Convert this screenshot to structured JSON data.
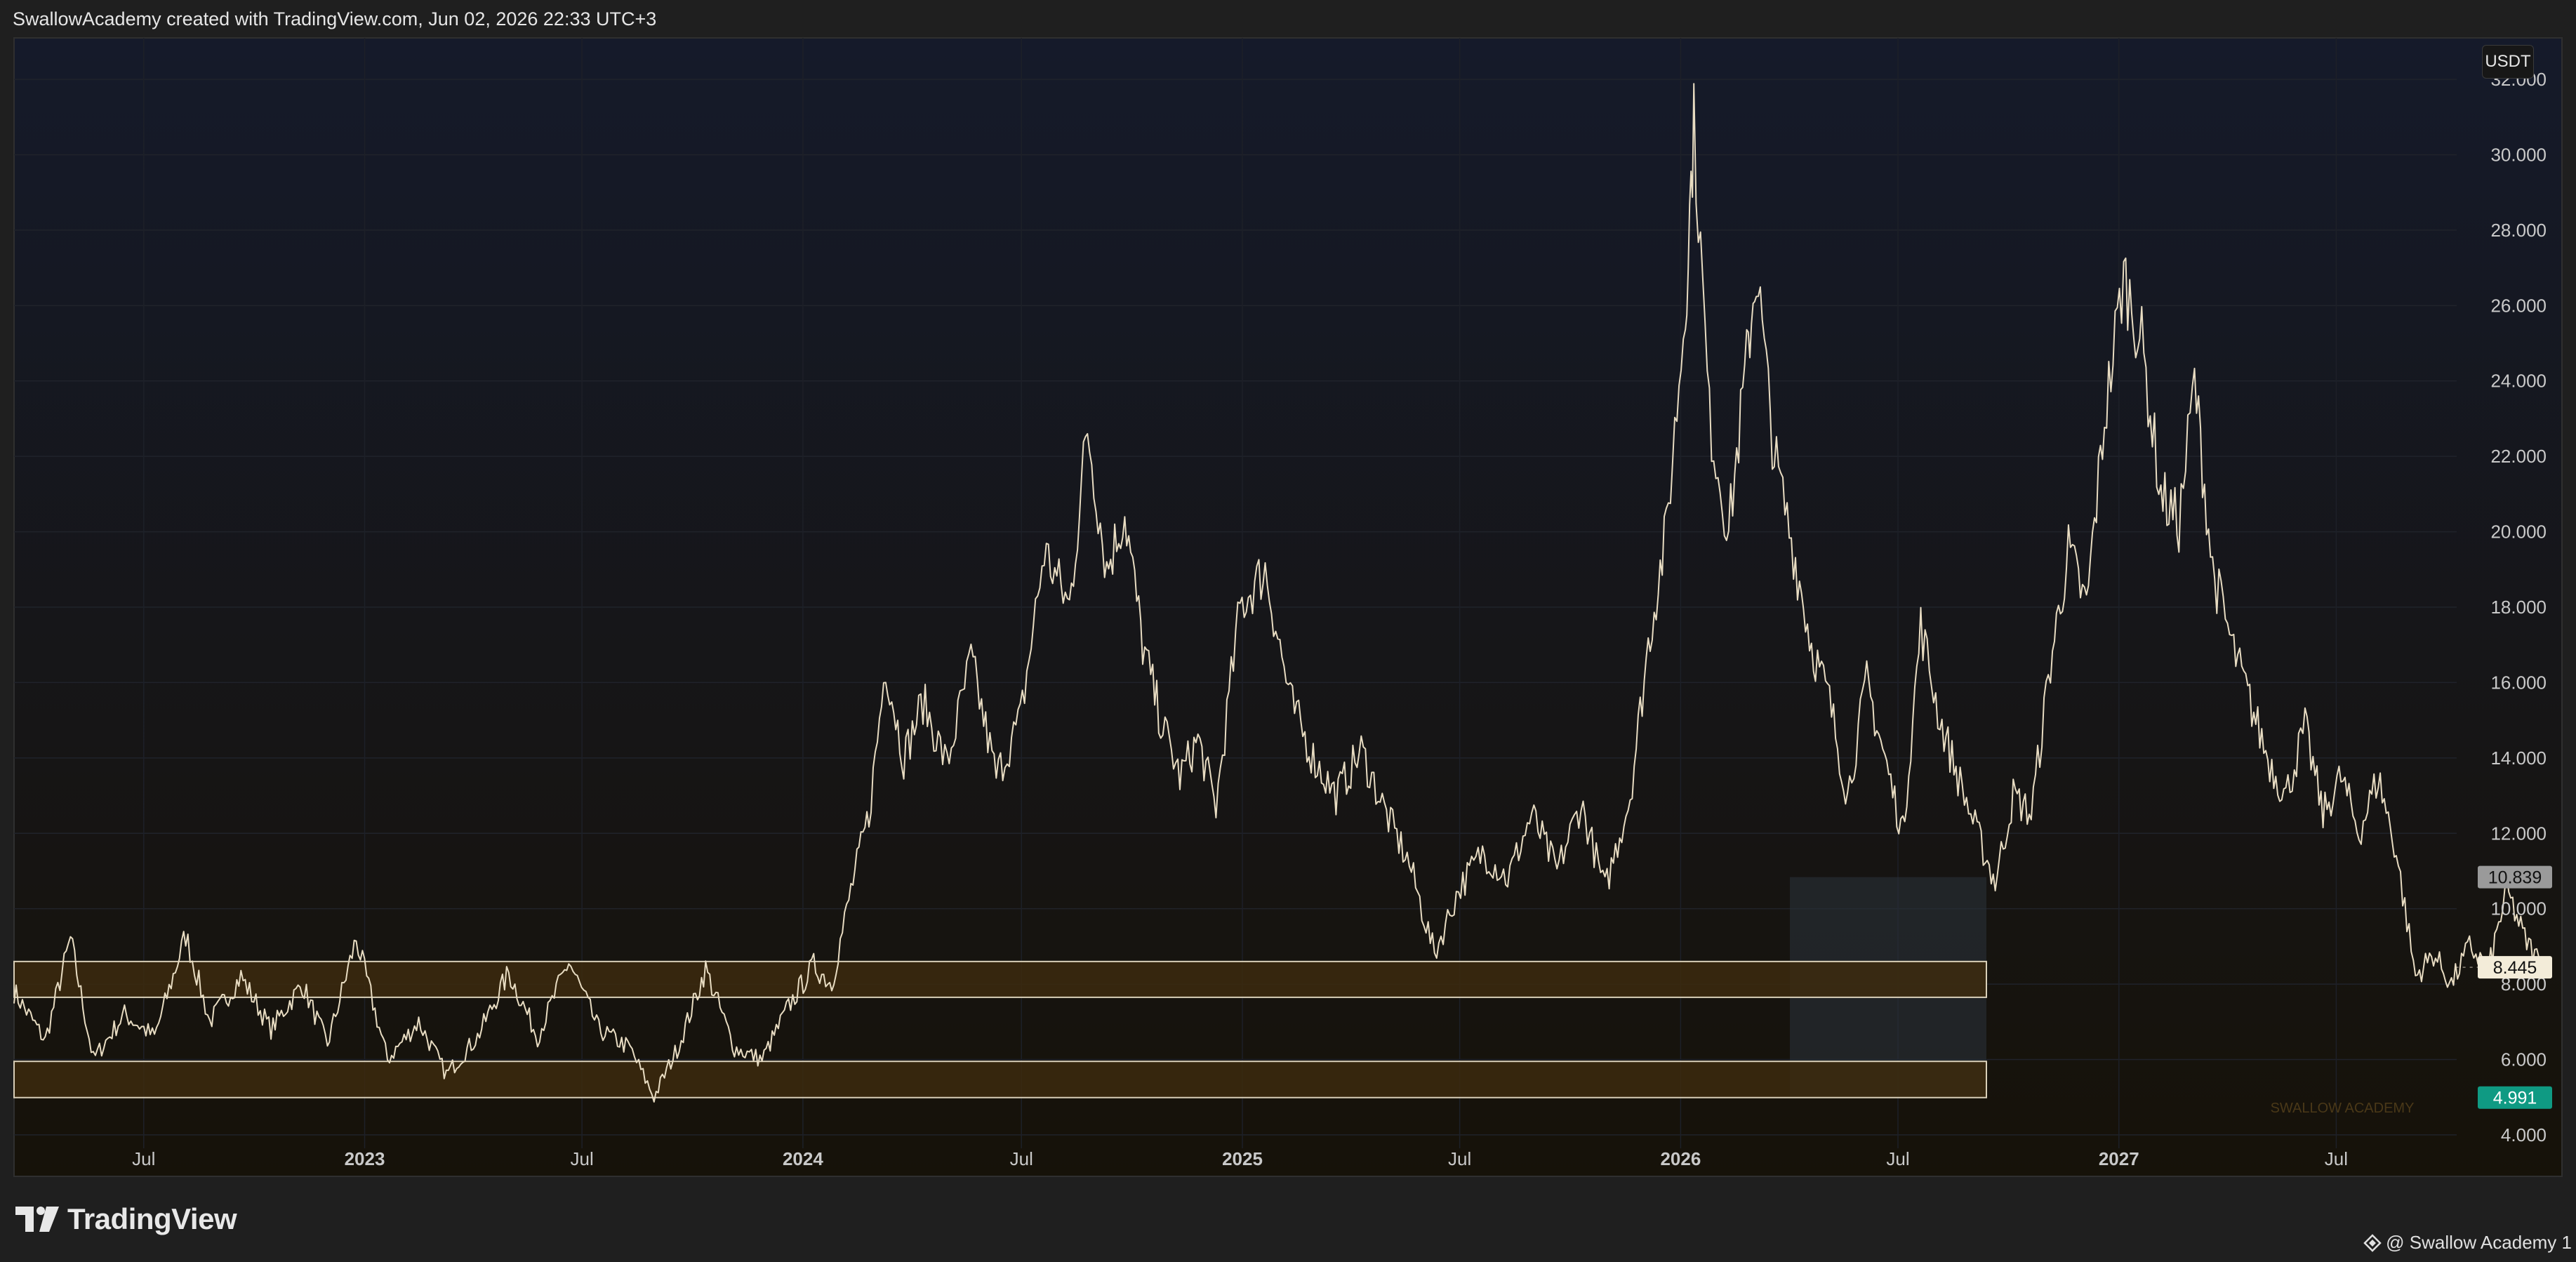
{
  "header": {
    "attribution": "SwallowAcademy created with TradingView.com, Jun 02, 2026 22:33 UTC+3"
  },
  "currency_badge": "USDT",
  "watermark": "SWALLOW ACADEMY",
  "footer": {
    "brand": "TradingView",
    "author": "@ Swallow Academy 1"
  },
  "colors": {
    "price_line": "#e8dcc2",
    "zone_fill": "#3c2a0e",
    "zone_border": "#d9cfb8",
    "projection_box": "#2a3038",
    "last_price_tag": "#f3ecd9",
    "target_tag": "#0f9a83",
    "upper_tag": "#9a9a9a",
    "background_top": "#151a2a",
    "background_bottom": "#161209"
  },
  "chart_data": {
    "type": "line",
    "title": "",
    "xlabel": "",
    "ylabel": "",
    "ylim": [
      2.9,
      33.1
    ],
    "xlim": [
      "2022-03-15",
      "2028-01-05"
    ],
    "grid": true,
    "y_ticks": [
      "32.000",
      "30.000",
      "28.000",
      "26.000",
      "24.000",
      "22.000",
      "20.000",
      "18.000",
      "16.000",
      "14.000",
      "12.000",
      "10.000",
      "8.000",
      "6.000",
      "4.000"
    ],
    "y_tick_values": [
      32,
      30,
      28,
      26,
      24,
      22,
      20,
      18,
      16,
      14,
      12,
      10,
      8,
      6,
      4
    ],
    "x_ticks": [
      {
        "label": "Jul",
        "date": "2022-07-01"
      },
      {
        "label": "2023",
        "date": "2023-01-01"
      },
      {
        "label": "Jul",
        "date": "2023-07-01"
      },
      {
        "label": "2024",
        "date": "2024-01-01"
      },
      {
        "label": "Jul",
        "date": "2024-07-01"
      },
      {
        "label": "2025",
        "date": "2025-01-01"
      },
      {
        "label": "Jul",
        "date": "2025-07-01"
      },
      {
        "label": "2026",
        "date": "2026-01-01"
      },
      {
        "label": "Jul",
        "date": "2026-07-01"
      },
      {
        "label": "2027",
        "date": "2027-01-01"
      },
      {
        "label": "Jul",
        "date": "2027-07-01"
      }
    ],
    "series": [
      {
        "points": [
          [
            "2022-03-15",
            7.8
          ],
          [
            "2022-04-10",
            6.5
          ],
          [
            "2022-05-01",
            9.2
          ],
          [
            "2022-05-20",
            6.0
          ],
          [
            "2022-06-15",
            7.2
          ],
          [
            "2022-07-10",
            6.6
          ],
          [
            "2022-08-05",
            9.3
          ],
          [
            "2022-08-25",
            7.0
          ],
          [
            "2022-09-20",
            8.2
          ],
          [
            "2022-10-15",
            6.8
          ],
          [
            "2022-11-10",
            8.0
          ],
          [
            "2022-12-01",
            6.4
          ],
          [
            "2022-12-25",
            9.2
          ],
          [
            "2023-01-20",
            6.0
          ],
          [
            "2023-02-15",
            7.0
          ],
          [
            "2023-03-10",
            5.6
          ],
          [
            "2023-04-05",
            6.6
          ],
          [
            "2023-05-01",
            8.3
          ],
          [
            "2023-05-25",
            6.6
          ],
          [
            "2023-06-20",
            8.6
          ],
          [
            "2023-07-15",
            6.8
          ],
          [
            "2023-08-10",
            6.3
          ],
          [
            "2023-08-30",
            5.0
          ],
          [
            "2023-09-20",
            6.4
          ],
          [
            "2023-10-12",
            8.4
          ],
          [
            "2023-11-05",
            6.3
          ],
          [
            "2023-11-28",
            6.0
          ],
          [
            "2023-12-20",
            7.4
          ],
          [
            "2024-01-10",
            8.5
          ],
          [
            "2024-01-25",
            8.0
          ],
          [
            "2024-02-10",
            10.5
          ],
          [
            "2024-02-25",
            12.5
          ],
          [
            "2024-03-10",
            16.5
          ],
          [
            "2024-03-25",
            14.0
          ],
          [
            "2024-04-10",
            15.5
          ],
          [
            "2024-04-30",
            13.8
          ],
          [
            "2024-05-20",
            16.6
          ],
          [
            "2024-06-10",
            13.5
          ],
          [
            "2024-06-30",
            15.0
          ],
          [
            "2024-07-20",
            19.5
          ],
          [
            "2024-08-10",
            18.0
          ],
          [
            "2024-08-25",
            22.8
          ],
          [
            "2024-09-10",
            19.0
          ],
          [
            "2024-09-25",
            20.5
          ],
          [
            "2024-10-10",
            17.0
          ],
          [
            "2024-10-25",
            15.0
          ],
          [
            "2024-11-10",
            13.5
          ],
          [
            "2024-11-25",
            14.5
          ],
          [
            "2024-12-10",
            12.7
          ],
          [
            "2024-12-30",
            18.0
          ],
          [
            "2025-01-20",
            19.0
          ],
          [
            "2025-02-10",
            15.5
          ],
          [
            "2025-03-01",
            14.0
          ],
          [
            "2025-03-20",
            13.0
          ],
          [
            "2025-04-10",
            14.2
          ],
          [
            "2025-05-01",
            12.5
          ],
          [
            "2025-05-20",
            11.2
          ],
          [
            "2025-06-10",
            8.8
          ],
          [
            "2025-06-30",
            10.5
          ],
          [
            "2025-07-20",
            11.5
          ],
          [
            "2025-08-10",
            10.8
          ],
          [
            "2025-08-30",
            12.5
          ],
          [
            "2025-09-20",
            11.0
          ],
          [
            "2025-10-10",
            12.8
          ],
          [
            "2025-10-30",
            10.5
          ],
          [
            "2025-11-20",
            13.0
          ],
          [
            "2025-12-05",
            17.0
          ],
          [
            "2025-12-20",
            20.0
          ],
          [
            "2026-01-05",
            26.0
          ],
          [
            "2026-01-12",
            30.8
          ],
          [
            "2026-01-25",
            23.0
          ],
          [
            "2026-02-10",
            20.0
          ],
          [
            "2026-02-25",
            24.5
          ],
          [
            "2026-03-05",
            27.0
          ],
          [
            "2026-03-20",
            22.0
          ],
          [
            "2026-04-05",
            19.5
          ],
          [
            "2026-04-20",
            17.0
          ],
          [
            "2026-05-05",
            15.5
          ],
          [
            "2026-05-20",
            13.0
          ],
          [
            "2026-06-05",
            16.0
          ],
          [
            "2026-06-20",
            14.0
          ],
          [
            "2026-07-05",
            12.0
          ],
          [
            "2026-07-20",
            17.5
          ],
          [
            "2026-08-05",
            15.0
          ],
          [
            "2026-08-20",
            13.5
          ],
          [
            "2026-09-05",
            12.0
          ],
          [
            "2026-09-20",
            10.7
          ],
          [
            "2026-10-05",
            13.0
          ],
          [
            "2026-10-20",
            12.5
          ],
          [
            "2026-11-05",
            16.5
          ],
          [
            "2026-11-20",
            19.5
          ],
          [
            "2026-12-05",
            18.0
          ],
          [
            "2026-12-20",
            23.0
          ],
          [
            "2027-01-05",
            26.8
          ],
          [
            "2027-01-20",
            25.0
          ],
          [
            "2027-02-05",
            21.0
          ],
          [
            "2027-02-20",
            20.2
          ],
          [
            "2027-03-05",
            24.0
          ],
          [
            "2027-03-20",
            19.0
          ],
          [
            "2027-04-05",
            17.0
          ],
          [
            "2027-04-20",
            15.5
          ],
          [
            "2027-05-05",
            14.0
          ],
          [
            "2027-05-20",
            13.0
          ],
          [
            "2027-06-05",
            14.8
          ],
          [
            "2027-06-20",
            12.5
          ],
          [
            "2027-07-05",
            13.5
          ],
          [
            "2027-07-20",
            12.0
          ],
          [
            "2027-08-05",
            13.5
          ],
          [
            "2027-08-20",
            11.5
          ],
          [
            "2027-09-05",
            8.2
          ],
          [
            "2027-09-20",
            8.8
          ],
          [
            "2027-10-05",
            8.0
          ],
          [
            "2027-10-20",
            9.0
          ],
          [
            "2027-11-05",
            8.4
          ],
          [
            "2027-11-20",
            10.5
          ],
          [
            "2027-12-05",
            9.2
          ],
          [
            "2027-12-20",
            8.445
          ]
        ]
      }
    ],
    "zones": [
      {
        "low": 7.65,
        "high": 8.6
      },
      {
        "low": 4.99,
        "high": 5.95
      }
    ],
    "projection_box": {
      "low": 4.991,
      "high": 10.839
    },
    "price_tags": [
      {
        "label": "10.839",
        "value": 10.839,
        "style": "upper"
      },
      {
        "label": "8.445",
        "value": 8.445,
        "style": "last"
      },
      {
        "label": "4.991",
        "value": 4.991,
        "style": "target"
      }
    ]
  }
}
